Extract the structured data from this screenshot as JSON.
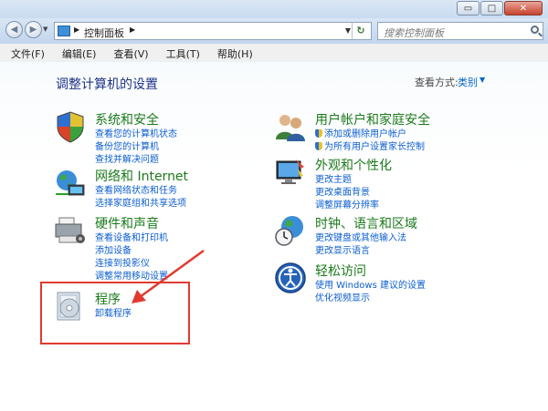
{
  "window": {
    "caption_buttons": {
      "minimize": "▭",
      "maximize": "□",
      "close": "✕"
    }
  },
  "navbar": {
    "back": "◀",
    "forward": "▶",
    "address_text": "控制面板",
    "search_placeholder": "搜索控制面板"
  },
  "menu": [
    "文件(F)",
    "编辑(E)",
    "查看(V)",
    "工具(T)",
    "帮助(H)"
  ],
  "header": {
    "title": "调整计算机的设置",
    "view_by_label": "查看方式:",
    "view_by_value": "类别"
  },
  "categories_left": [
    {
      "title": "系统和安全",
      "icon": "system-security-icon",
      "links": [
        "查看您的计算机状态",
        "备份您的计算机",
        "查找并解决问题"
      ]
    },
    {
      "title": "网络和 Internet",
      "icon": "network-icon",
      "links": [
        "查看网络状态和任务",
        "选择家庭组和共享选项"
      ]
    },
    {
      "title": "硬件和声音",
      "icon": "hardware-sound-icon",
      "links": [
        "查看设备和打印机",
        "添加设备",
        "连接到投影仪",
        "调整常用移动设置"
      ]
    },
    {
      "title": "程序",
      "icon": "programs-icon",
      "links": [
        "卸载程序"
      ]
    }
  ],
  "categories_right": [
    {
      "title": "用户帐户和家庭安全",
      "icon": "user-accounts-icon",
      "links": [
        "添加或删除用户帐户",
        "为所有用户设置家长控制"
      ]
    },
    {
      "title": "外观和个性化",
      "icon": "appearance-icon",
      "links": [
        "更改主题",
        "更改桌面背景",
        "调整屏幕分辨率"
      ]
    },
    {
      "title": "时钟、语言和区域",
      "icon": "clock-language-icon",
      "links": [
        "更改键盘或其他输入法",
        "更改显示语言"
      ]
    },
    {
      "title": "轻松访问",
      "icon": "ease-of-access-icon",
      "links": [
        "使用 Windows 建议的设置",
        "优化视频显示"
      ]
    }
  ],
  "annotation": {
    "color": "#e03a30"
  }
}
